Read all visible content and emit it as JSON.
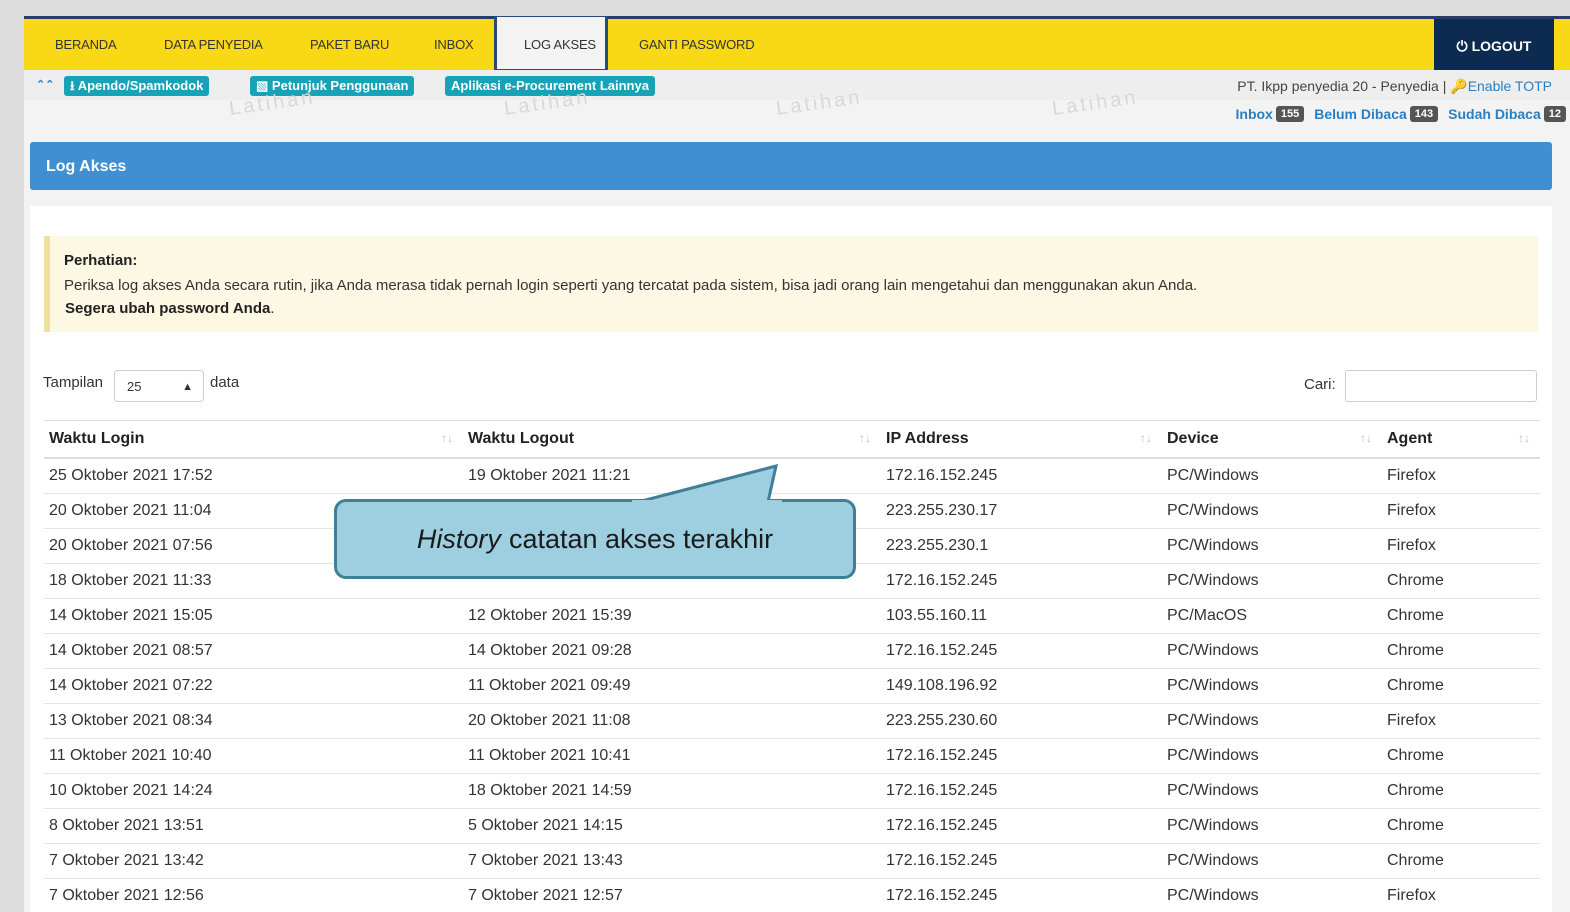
{
  "nav": {
    "items": [
      "BERANDA",
      "DATA PENYEDIA",
      "PAKET BARU",
      "INBOX",
      "LOG AKSES",
      "GANTI PASSWORD"
    ],
    "active": "LOG AKSES",
    "logout": "LOGOUT"
  },
  "subbar": {
    "links": [
      "Apendo/Spamkodok",
      "Petunjuk Penggunaan",
      "Aplikasi e-Procurement Lainnya"
    ],
    "user": "PT. Ikpp penyedia 20 - Penyedia |",
    "totp": "Enable TOTP",
    "watermark": "Latihan"
  },
  "counters": [
    {
      "label": "Inbox",
      "count": "155"
    },
    {
      "label": "Belum Dibaca",
      "count": "143"
    },
    {
      "label": "Sudah Dibaca",
      "count": "12"
    }
  ],
  "panel": {
    "title": "Log Akses"
  },
  "alert": {
    "title": "Perhatian:",
    "message": "Periksa log akses Anda secara rutin, jika Anda merasa tidak pernah login seperti yang tercatat pada sistem, bisa jadi orang lain mengetahui dan menggunakan akun Anda.",
    "strong": "Segera ubah password Anda",
    "strong_suffix": "."
  },
  "controls": {
    "show_label": "Tampilan",
    "page_size": "25",
    "show_suffix": "data",
    "search_label": "Cari:"
  },
  "table": {
    "headers": [
      "Waktu Login",
      "Waktu Logout",
      "IP Address",
      "Device",
      "Agent"
    ],
    "rows": [
      [
        "25 Oktober 2021 17:52",
        "19 Oktober 2021 11:21",
        "172.16.152.245",
        "PC/Windows",
        "Firefox"
      ],
      [
        "20 Oktober 2021 11:04",
        "",
        "223.255.230.17",
        "PC/Windows",
        "Firefox"
      ],
      [
        "20 Oktober 2021 07:56",
        "",
        "223.255.230.1",
        "PC/Windows",
        "Firefox"
      ],
      [
        "18 Oktober 2021 11:33",
        "",
        "172.16.152.245",
        "PC/Windows",
        "Chrome"
      ],
      [
        "14 Oktober 2021 15:05",
        "12 Oktober 2021 15:39",
        "103.55.160.11",
        "PC/MacOS",
        "Chrome"
      ],
      [
        "14 Oktober 2021 08:57",
        "14 Oktober 2021 09:28",
        "172.16.152.245",
        "PC/Windows",
        "Chrome"
      ],
      [
        "14 Oktober 2021 07:22",
        "11 Oktober 2021 09:49",
        "149.108.196.92",
        "PC/Windows",
        "Chrome"
      ],
      [
        "13 Oktober 2021 08:34",
        "20 Oktober 2021 11:08",
        "223.255.230.60",
        "PC/Windows",
        "Firefox"
      ],
      [
        "11 Oktober 2021 10:40",
        "11 Oktober 2021 10:41",
        "172.16.152.245",
        "PC/Windows",
        "Chrome"
      ],
      [
        "10 Oktober 2021 14:24",
        "18 Oktober 2021 14:59",
        "172.16.152.245",
        "PC/Windows",
        "Chrome"
      ],
      [
        "8 Oktober 2021 13:51",
        "5 Oktober 2021 14:15",
        "172.16.152.245",
        "PC/Windows",
        "Chrome"
      ],
      [
        "7 Oktober 2021 13:42",
        "7 Oktober 2021 13:43",
        "172.16.152.245",
        "PC/Windows",
        "Chrome"
      ],
      [
        "7 Oktober 2021 12:56",
        "7 Oktober 2021 12:57",
        "172.16.152.245",
        "PC/Windows",
        "Firefox"
      ]
    ]
  },
  "callout": {
    "italic": "History",
    "text": "catatan akses terakhir"
  },
  "colors": {
    "navbar": "#f9d916",
    "logout_bg": "#0d2a50",
    "panel": "#3f8fd2",
    "pill": "#17a2b8",
    "callout": "#9ecfe1"
  }
}
